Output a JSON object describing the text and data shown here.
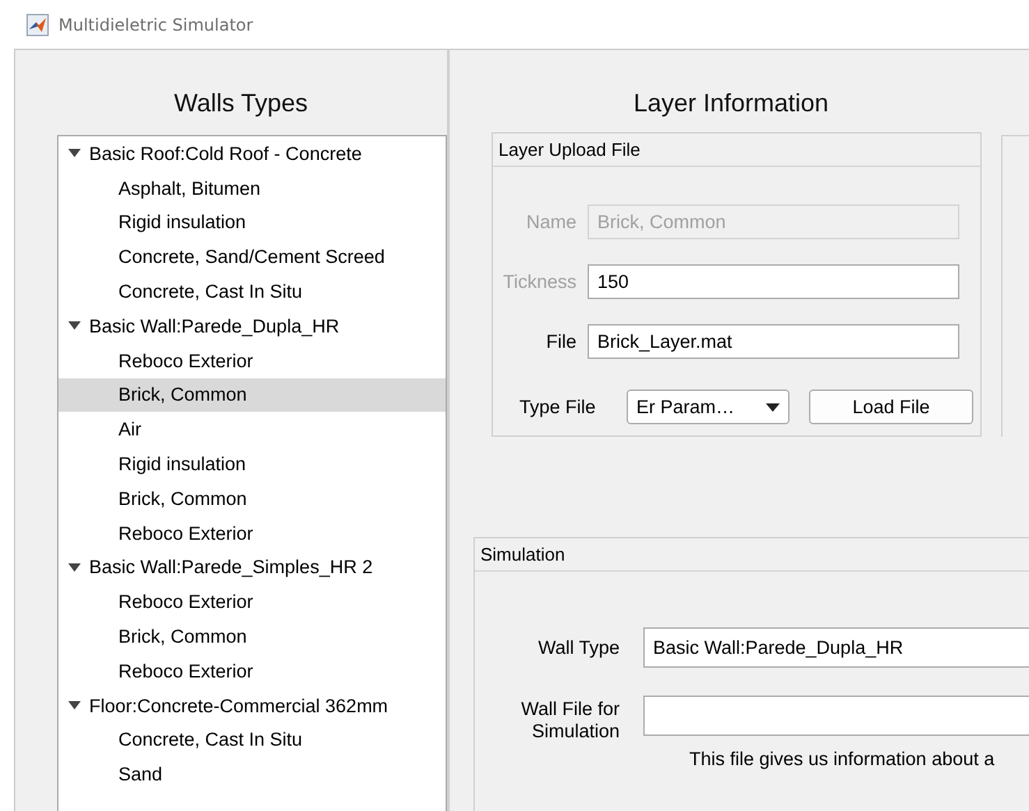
{
  "window": {
    "title": "Multidieletric Simulator"
  },
  "walls_panel": {
    "title": "Walls Types",
    "tree": [
      {
        "label": "Basic Roof:Cold Roof - Concrete",
        "expanded": true,
        "selected": false,
        "children": [
          {
            "label": "Asphalt, Bitumen",
            "selected": false
          },
          {
            "label": "Rigid insulation",
            "selected": false
          },
          {
            "label": "Concrete, Sand/Cement Screed",
            "selected": false
          },
          {
            "label": "Concrete, Cast In Situ",
            "selected": false
          }
        ]
      },
      {
        "label": "Basic Wall:Parede_Dupla_HR",
        "expanded": true,
        "selected": false,
        "children": [
          {
            "label": "Reboco Exterior",
            "selected": false
          },
          {
            "label": "Brick, Common",
            "selected": true
          },
          {
            "label": "Air",
            "selected": false
          },
          {
            "label": "Rigid insulation",
            "selected": false
          },
          {
            "label": "Brick, Common",
            "selected": false
          },
          {
            "label": "Reboco Exterior",
            "selected": false
          }
        ]
      },
      {
        "label": "Basic Wall:Parede_Simples_HR 2",
        "expanded": true,
        "selected": false,
        "children": [
          {
            "label": "Reboco Exterior",
            "selected": false
          },
          {
            "label": "Brick, Common",
            "selected": false
          },
          {
            "label": "Reboco Exterior",
            "selected": false
          }
        ]
      },
      {
        "label": "Floor:Concrete-Commercial 362mm",
        "expanded": true,
        "selected": false,
        "children": [
          {
            "label": "Concrete, Cast In Situ",
            "selected": false
          },
          {
            "label": "Sand",
            "selected": false
          }
        ]
      }
    ]
  },
  "layer_panel": {
    "title": "Layer Information",
    "upload": {
      "title": "Layer Upload File",
      "fields": [
        {
          "label": "Name",
          "value": "Brick, Common",
          "disabled": true,
          "label_disabled": true
        },
        {
          "label": "Tickness",
          "value": "150",
          "disabled": false,
          "label_disabled": true
        },
        {
          "label": "File",
          "value": "Brick_Layer.mat",
          "disabled": false,
          "label_disabled": false
        }
      ],
      "type_file": {
        "label": "Type File",
        "value": "Er Param…"
      },
      "load_button": "Load File"
    }
  },
  "simulation": {
    "title": "Simulation",
    "wall_type": {
      "label": "Wall Type",
      "value": "Basic Wall:Parede_Dupla_HR"
    },
    "wall_file": {
      "label": "Wall File for Simulation",
      "hint": "This file gives us information about a"
    }
  }
}
